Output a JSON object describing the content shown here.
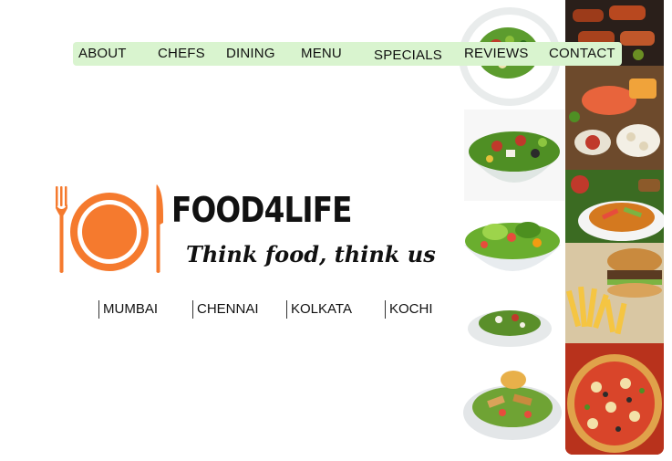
{
  "nav": {
    "items": [
      {
        "label": "ABOUT"
      },
      {
        "label": "CHEFS"
      },
      {
        "label": "DINING"
      },
      {
        "label": "MENU"
      },
      {
        "label": "SPECIALS"
      },
      {
        "label": "REVIEWS"
      },
      {
        "label": "CONTACT"
      }
    ]
  },
  "brand": {
    "name": "FOOD4LIFE",
    "tagline": "Think food, think us",
    "logo_icon": "fork-plate-knife-icon"
  },
  "cities": [
    {
      "label": "MUMBAI"
    },
    {
      "label": "CHENNAI"
    },
    {
      "label": "KOLKATA"
    },
    {
      "label": "KOCHI"
    }
  ],
  "collage": {
    "images": [
      {
        "name": "salad-plate-image"
      },
      {
        "name": "greek-salad-bowl-image"
      },
      {
        "name": "green-salad-bowl-image"
      },
      {
        "name": "small-salad-plate-image"
      },
      {
        "name": "chicken-salad-plate-image"
      },
      {
        "name": "grilled-meat-image"
      },
      {
        "name": "salmon-platter-image"
      },
      {
        "name": "spicy-stirfry-image"
      },
      {
        "name": "burger-fries-image"
      },
      {
        "name": "pizza-image"
      }
    ]
  },
  "colors": {
    "nav_bg": "#d9f4cf",
    "logo_orange": "#f57a2e",
    "text": "#111111"
  }
}
